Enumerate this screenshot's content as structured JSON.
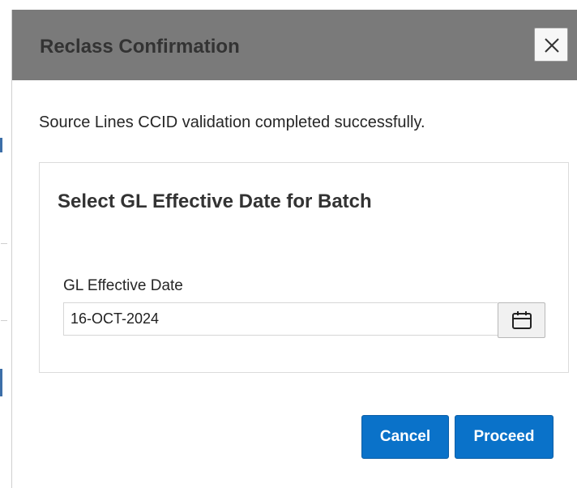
{
  "dialog": {
    "title": "Reclass Confirmation",
    "message": "Source Lines CCID validation completed successfully."
  },
  "panel": {
    "title": "Select GL Effective Date for Batch",
    "field_label": "GL Effective Date",
    "field_value": "16-OCT-2024"
  },
  "actions": {
    "cancel_label": "Cancel",
    "proceed_label": "Proceed"
  },
  "icons": {
    "close": "close-icon",
    "calendar": "calendar-icon"
  },
  "colors": {
    "header_bg": "#7a7a7a",
    "primary_button": "#0a72c9"
  }
}
